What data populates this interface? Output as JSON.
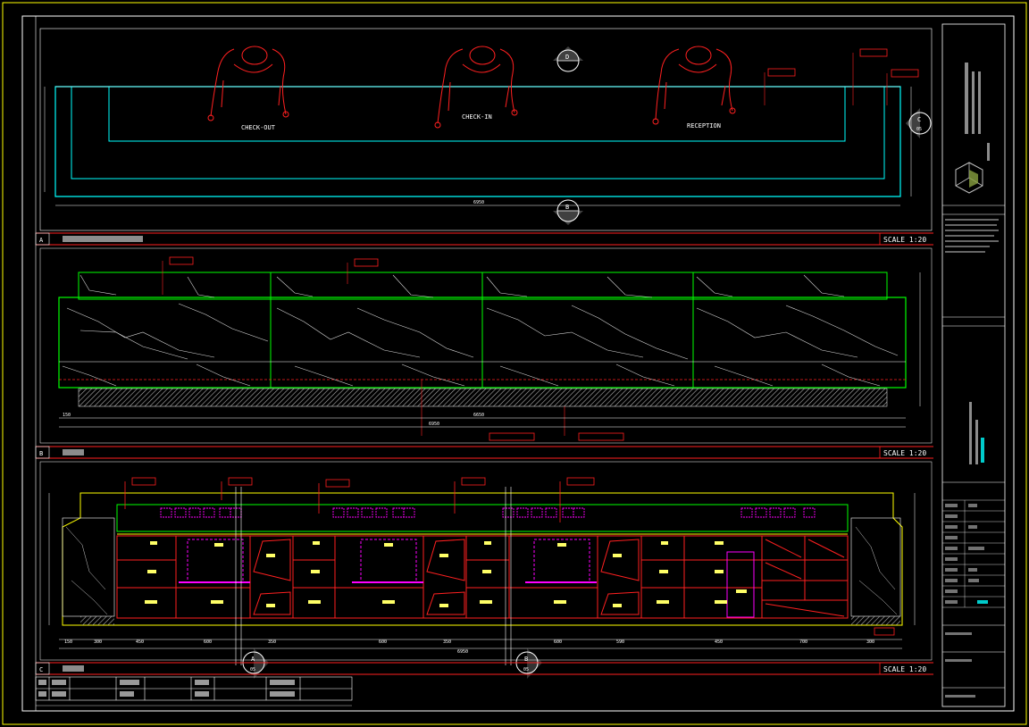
{
  "plan_labels": {
    "check_out": "CHECK-OUT",
    "check_in": "CHECK-IN",
    "reception": "RECEPTION"
  },
  "sections": [
    {
      "id": "A",
      "scale": "SCALE 1:20"
    },
    {
      "id": "B",
      "scale": "SCALE 1:20"
    },
    {
      "id": "C",
      "scale": "SCALE 1:20"
    }
  ],
  "dimensions": {
    "plan_total": "6950",
    "elev_left": "150",
    "elev_total": "6950",
    "elev_mid": "6650",
    "front_total": "6950",
    "front_segments": [
      "150",
      "300",
      "450",
      "600",
      "350",
      "600",
      "350",
      "600",
      "590",
      "450",
      "700",
      "300"
    ]
  },
  "markers": {
    "top_section": "D",
    "plan_bottom": "B",
    "plan_right": "C",
    "front_a": "A",
    "front_b": "B",
    "sheet_ref": "05"
  },
  "colors": {
    "frame": "#ffff00",
    "red": "#ff2020",
    "cyan": "#00ffff",
    "green": "#00ff00",
    "magenta": "#ff00ff",
    "white": "#ffffff",
    "gray": "#808080"
  }
}
